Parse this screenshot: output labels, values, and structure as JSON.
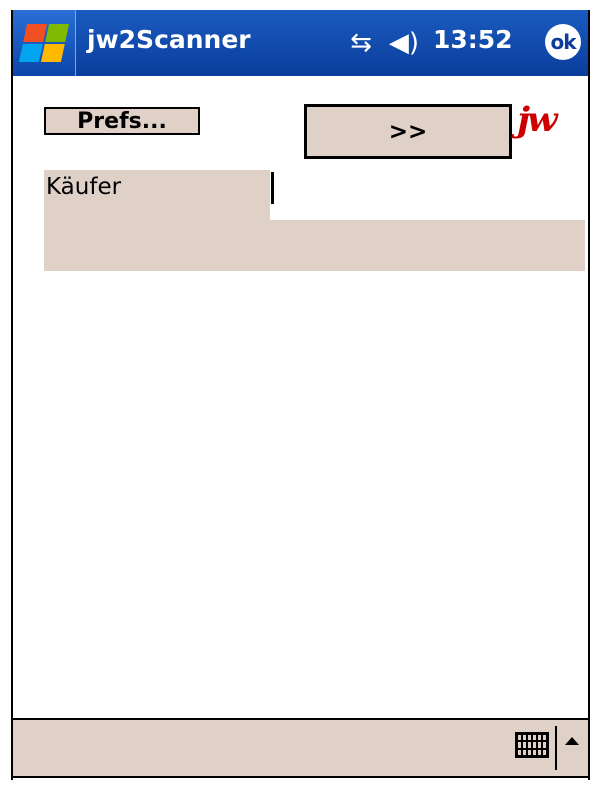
{
  "titlebar": {
    "app_title": "jw2Scanner",
    "time": "13:52",
    "ok_label": "ok",
    "start_icon": "windows-start-icon",
    "connectivity_icon": "connectivity-icon",
    "volume_icon": "volume-icon"
  },
  "toolbar": {
    "prefs_label": "Prefs...",
    "next_label": ">>",
    "logo_text": "jw"
  },
  "form": {
    "buyer_label": "Käufer",
    "buyer_value": ""
  },
  "bottom_bar": {
    "keyboard_icon": "keyboard-icon",
    "sip_arrow_icon": "arrow-up-icon"
  },
  "colors": {
    "titlebar": "#0a3d9c",
    "panel": "#dfd0c8",
    "logo": "#cc0000"
  }
}
